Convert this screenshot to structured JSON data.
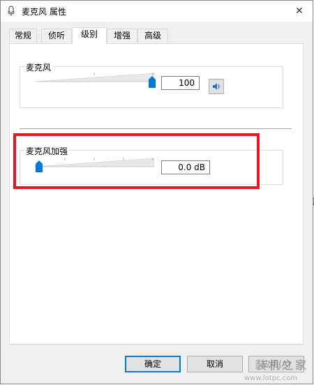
{
  "window": {
    "title": "麦克风 属性"
  },
  "tabs": [
    "常规",
    "侦听",
    "级别",
    "增强",
    "高级"
  ],
  "active_tab": "级别",
  "microphone": {
    "label": "麦克风",
    "value": "100",
    "level": 1.0
  },
  "boost": {
    "label": "麦克风加强",
    "value": "0.0 dB",
    "level": 0.0
  },
  "buttons": {
    "ok": "确定",
    "cancel": "取消",
    "apply": "应用(A)"
  },
  "side_fragments": {
    "right": "分"
  },
  "watermark": {
    "brand": "装机之家",
    "url": "www.lotpc.com"
  },
  "colors": {
    "thumb": "#0078d7",
    "highlight": "#e8171f",
    "primary_border": "#0078d7"
  }
}
